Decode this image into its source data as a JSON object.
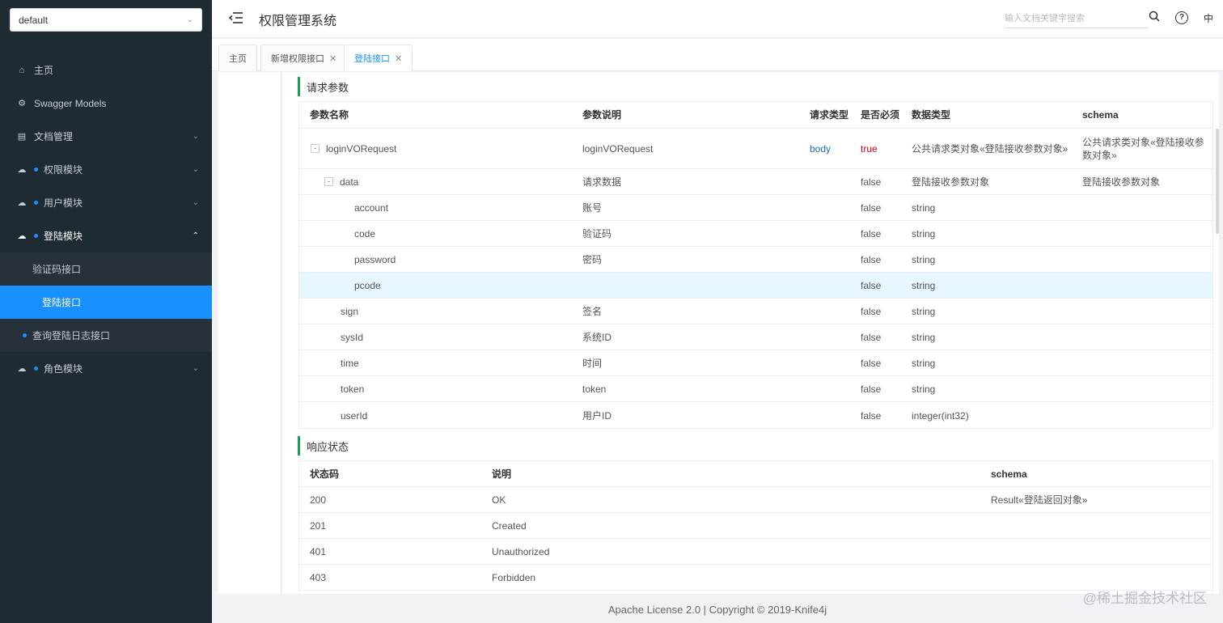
{
  "sidebar": {
    "group_select": "default",
    "items": [
      {
        "label": "主页",
        "icon": "home-icon"
      },
      {
        "label": "Swagger Models",
        "icon": "gear-icon"
      },
      {
        "label": "文档管理",
        "icon": "document-icon"
      },
      {
        "label": "权限模块",
        "icon": "cloud-icon"
      },
      {
        "label": "用户模块",
        "icon": "cloud-icon"
      },
      {
        "label": "登陆模块",
        "icon": "cloud-icon"
      },
      {
        "label": "角色模块",
        "icon": "cloud-icon"
      }
    ],
    "submenu": [
      "验证码接口",
      "登陆接口",
      "查询登陆日志接口"
    ]
  },
  "header": {
    "title": "权限管理系统",
    "search_placeholder": "输入文档关键字搜索",
    "lang": "中"
  },
  "tabs": [
    {
      "label": "主页"
    },
    {
      "label": "新增权限接口"
    },
    {
      "label": "登陆接口"
    }
  ],
  "request": {
    "title": "请求参数",
    "columns": [
      "参数名称",
      "参数说明",
      "请求类型",
      "是否必须",
      "数据类型",
      "schema"
    ],
    "rows": [
      {
        "name": "loginVORequest",
        "desc": "loginVORequest",
        "in": "body",
        "required": "true",
        "type": "公共请求类对象«登陆接收参数对象»",
        "schema": "公共请求类对象«登陆接收参数对象»"
      },
      {
        "name": "data",
        "desc": "请求数据",
        "in": "",
        "required": "false",
        "type": "登陆接收参数对象",
        "schema": "登陆接收参数对象"
      },
      {
        "name": "account",
        "desc": "账号",
        "in": "",
        "required": "false",
        "type": "string",
        "schema": ""
      },
      {
        "name": "code",
        "desc": "验证码",
        "in": "",
        "required": "false",
        "type": "string",
        "schema": ""
      },
      {
        "name": "password",
        "desc": "密码",
        "in": "",
        "required": "false",
        "type": "string",
        "schema": ""
      },
      {
        "name": "pcode",
        "desc": "",
        "in": "",
        "required": "false",
        "type": "string",
        "schema": ""
      },
      {
        "name": "sign",
        "desc": "签名",
        "in": "",
        "required": "false",
        "type": "string",
        "schema": ""
      },
      {
        "name": "sysId",
        "desc": "系统ID",
        "in": "",
        "required": "false",
        "type": "string",
        "schema": ""
      },
      {
        "name": "time",
        "desc": "时间",
        "in": "",
        "required": "false",
        "type": "string",
        "schema": ""
      },
      {
        "name": "token",
        "desc": "token",
        "in": "",
        "required": "false",
        "type": "string",
        "schema": ""
      },
      {
        "name": "userId",
        "desc": "用户ID",
        "in": "",
        "required": "false",
        "type": "integer(int32)",
        "schema": ""
      }
    ]
  },
  "response": {
    "title": "响应状态",
    "columns": [
      "状态码",
      "说明",
      "schema"
    ],
    "rows": [
      {
        "code": "200",
        "desc": "OK",
        "schema": "Result«登陆返回对象»"
      },
      {
        "code": "201",
        "desc": "Created",
        "schema": ""
      },
      {
        "code": "401",
        "desc": "Unauthorized",
        "schema": ""
      },
      {
        "code": "403",
        "desc": "Forbidden",
        "schema": ""
      }
    ]
  },
  "footer": "Apache License 2.0 | Copyright © 2019-Knife4j",
  "watermark": "@稀土掘金技术社区"
}
